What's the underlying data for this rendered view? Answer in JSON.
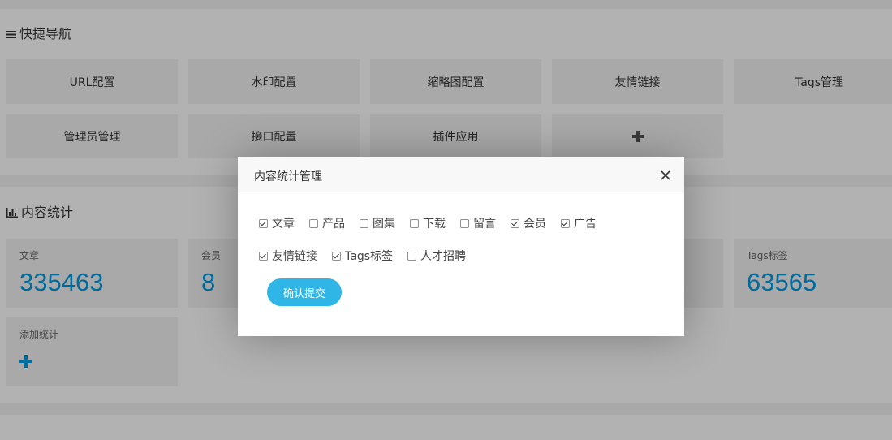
{
  "quick_nav": {
    "title": "快捷导航",
    "tiles": [
      {
        "label": "URL配置"
      },
      {
        "label": "水印配置"
      },
      {
        "label": "缩略图配置"
      },
      {
        "label": "友情链接"
      },
      {
        "label": "Tags管理"
      },
      {
        "label": "管理员管理"
      },
      {
        "label": "接口配置"
      },
      {
        "label": "插件应用"
      }
    ]
  },
  "content_stats": {
    "title": "内容统计",
    "tiles": [
      {
        "label": "文章",
        "value": "335463"
      },
      {
        "label": "会员",
        "value": "8"
      },
      {
        "label": "Tags标签",
        "value": "63565"
      }
    ],
    "add_label": "添加统计"
  },
  "colors": {
    "accent": "#009be1",
    "button": "#2fb6e6",
    "overlay": "rgba(0,0,0,0.3)"
  },
  "modal": {
    "title": "内容统计管理",
    "options": [
      {
        "label": "文章",
        "checked": true
      },
      {
        "label": "产品",
        "checked": false
      },
      {
        "label": "图集",
        "checked": false
      },
      {
        "label": "下载",
        "checked": false
      },
      {
        "label": "留言",
        "checked": false
      },
      {
        "label": "会员",
        "checked": true
      },
      {
        "label": "广告",
        "checked": true
      },
      {
        "label": "友情链接",
        "checked": true
      },
      {
        "label": "Tags标签",
        "checked": true
      },
      {
        "label": "人才招聘",
        "checked": false
      }
    ],
    "submit_label": "确认提交"
  }
}
